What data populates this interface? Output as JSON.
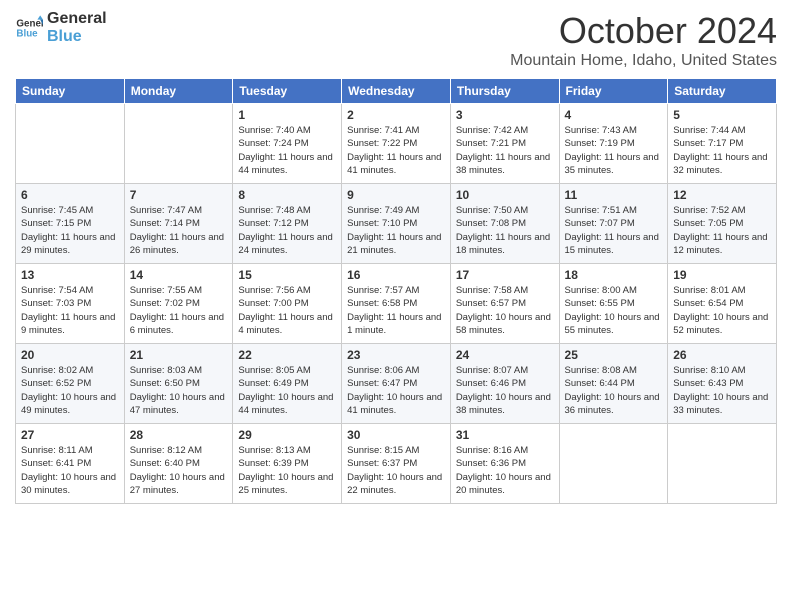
{
  "logo": {
    "line1": "General",
    "line2": "Blue"
  },
  "title": "October 2024",
  "location": "Mountain Home, Idaho, United States",
  "days_of_week": [
    "Sunday",
    "Monday",
    "Tuesday",
    "Wednesday",
    "Thursday",
    "Friday",
    "Saturday"
  ],
  "weeks": [
    [
      {
        "day": "",
        "sunrise": "",
        "sunset": "",
        "daylight": ""
      },
      {
        "day": "",
        "sunrise": "",
        "sunset": "",
        "daylight": ""
      },
      {
        "day": "1",
        "sunrise": "Sunrise: 7:40 AM",
        "sunset": "Sunset: 7:24 PM",
        "daylight": "Daylight: 11 hours and 44 minutes."
      },
      {
        "day": "2",
        "sunrise": "Sunrise: 7:41 AM",
        "sunset": "Sunset: 7:22 PM",
        "daylight": "Daylight: 11 hours and 41 minutes."
      },
      {
        "day": "3",
        "sunrise": "Sunrise: 7:42 AM",
        "sunset": "Sunset: 7:21 PM",
        "daylight": "Daylight: 11 hours and 38 minutes."
      },
      {
        "day": "4",
        "sunrise": "Sunrise: 7:43 AM",
        "sunset": "Sunset: 7:19 PM",
        "daylight": "Daylight: 11 hours and 35 minutes."
      },
      {
        "day": "5",
        "sunrise": "Sunrise: 7:44 AM",
        "sunset": "Sunset: 7:17 PM",
        "daylight": "Daylight: 11 hours and 32 minutes."
      }
    ],
    [
      {
        "day": "6",
        "sunrise": "Sunrise: 7:45 AM",
        "sunset": "Sunset: 7:15 PM",
        "daylight": "Daylight: 11 hours and 29 minutes."
      },
      {
        "day": "7",
        "sunrise": "Sunrise: 7:47 AM",
        "sunset": "Sunset: 7:14 PM",
        "daylight": "Daylight: 11 hours and 26 minutes."
      },
      {
        "day": "8",
        "sunrise": "Sunrise: 7:48 AM",
        "sunset": "Sunset: 7:12 PM",
        "daylight": "Daylight: 11 hours and 24 minutes."
      },
      {
        "day": "9",
        "sunrise": "Sunrise: 7:49 AM",
        "sunset": "Sunset: 7:10 PM",
        "daylight": "Daylight: 11 hours and 21 minutes."
      },
      {
        "day": "10",
        "sunrise": "Sunrise: 7:50 AM",
        "sunset": "Sunset: 7:08 PM",
        "daylight": "Daylight: 11 hours and 18 minutes."
      },
      {
        "day": "11",
        "sunrise": "Sunrise: 7:51 AM",
        "sunset": "Sunset: 7:07 PM",
        "daylight": "Daylight: 11 hours and 15 minutes."
      },
      {
        "day": "12",
        "sunrise": "Sunrise: 7:52 AM",
        "sunset": "Sunset: 7:05 PM",
        "daylight": "Daylight: 11 hours and 12 minutes."
      }
    ],
    [
      {
        "day": "13",
        "sunrise": "Sunrise: 7:54 AM",
        "sunset": "Sunset: 7:03 PM",
        "daylight": "Daylight: 11 hours and 9 minutes."
      },
      {
        "day": "14",
        "sunrise": "Sunrise: 7:55 AM",
        "sunset": "Sunset: 7:02 PM",
        "daylight": "Daylight: 11 hours and 6 minutes."
      },
      {
        "day": "15",
        "sunrise": "Sunrise: 7:56 AM",
        "sunset": "Sunset: 7:00 PM",
        "daylight": "Daylight: 11 hours and 4 minutes."
      },
      {
        "day": "16",
        "sunrise": "Sunrise: 7:57 AM",
        "sunset": "Sunset: 6:58 PM",
        "daylight": "Daylight: 11 hours and 1 minute."
      },
      {
        "day": "17",
        "sunrise": "Sunrise: 7:58 AM",
        "sunset": "Sunset: 6:57 PM",
        "daylight": "Daylight: 10 hours and 58 minutes."
      },
      {
        "day": "18",
        "sunrise": "Sunrise: 8:00 AM",
        "sunset": "Sunset: 6:55 PM",
        "daylight": "Daylight: 10 hours and 55 minutes."
      },
      {
        "day": "19",
        "sunrise": "Sunrise: 8:01 AM",
        "sunset": "Sunset: 6:54 PM",
        "daylight": "Daylight: 10 hours and 52 minutes."
      }
    ],
    [
      {
        "day": "20",
        "sunrise": "Sunrise: 8:02 AM",
        "sunset": "Sunset: 6:52 PM",
        "daylight": "Daylight: 10 hours and 49 minutes."
      },
      {
        "day": "21",
        "sunrise": "Sunrise: 8:03 AM",
        "sunset": "Sunset: 6:50 PM",
        "daylight": "Daylight: 10 hours and 47 minutes."
      },
      {
        "day": "22",
        "sunrise": "Sunrise: 8:05 AM",
        "sunset": "Sunset: 6:49 PM",
        "daylight": "Daylight: 10 hours and 44 minutes."
      },
      {
        "day": "23",
        "sunrise": "Sunrise: 8:06 AM",
        "sunset": "Sunset: 6:47 PM",
        "daylight": "Daylight: 10 hours and 41 minutes."
      },
      {
        "day": "24",
        "sunrise": "Sunrise: 8:07 AM",
        "sunset": "Sunset: 6:46 PM",
        "daylight": "Daylight: 10 hours and 38 minutes."
      },
      {
        "day": "25",
        "sunrise": "Sunrise: 8:08 AM",
        "sunset": "Sunset: 6:44 PM",
        "daylight": "Daylight: 10 hours and 36 minutes."
      },
      {
        "day": "26",
        "sunrise": "Sunrise: 8:10 AM",
        "sunset": "Sunset: 6:43 PM",
        "daylight": "Daylight: 10 hours and 33 minutes."
      }
    ],
    [
      {
        "day": "27",
        "sunrise": "Sunrise: 8:11 AM",
        "sunset": "Sunset: 6:41 PM",
        "daylight": "Daylight: 10 hours and 30 minutes."
      },
      {
        "day": "28",
        "sunrise": "Sunrise: 8:12 AM",
        "sunset": "Sunset: 6:40 PM",
        "daylight": "Daylight: 10 hours and 27 minutes."
      },
      {
        "day": "29",
        "sunrise": "Sunrise: 8:13 AM",
        "sunset": "Sunset: 6:39 PM",
        "daylight": "Daylight: 10 hours and 25 minutes."
      },
      {
        "day": "30",
        "sunrise": "Sunrise: 8:15 AM",
        "sunset": "Sunset: 6:37 PM",
        "daylight": "Daylight: 10 hours and 22 minutes."
      },
      {
        "day": "31",
        "sunrise": "Sunrise: 8:16 AM",
        "sunset": "Sunset: 6:36 PM",
        "daylight": "Daylight: 10 hours and 20 minutes."
      },
      {
        "day": "",
        "sunrise": "",
        "sunset": "",
        "daylight": ""
      },
      {
        "day": "",
        "sunrise": "",
        "sunset": "",
        "daylight": ""
      }
    ]
  ]
}
